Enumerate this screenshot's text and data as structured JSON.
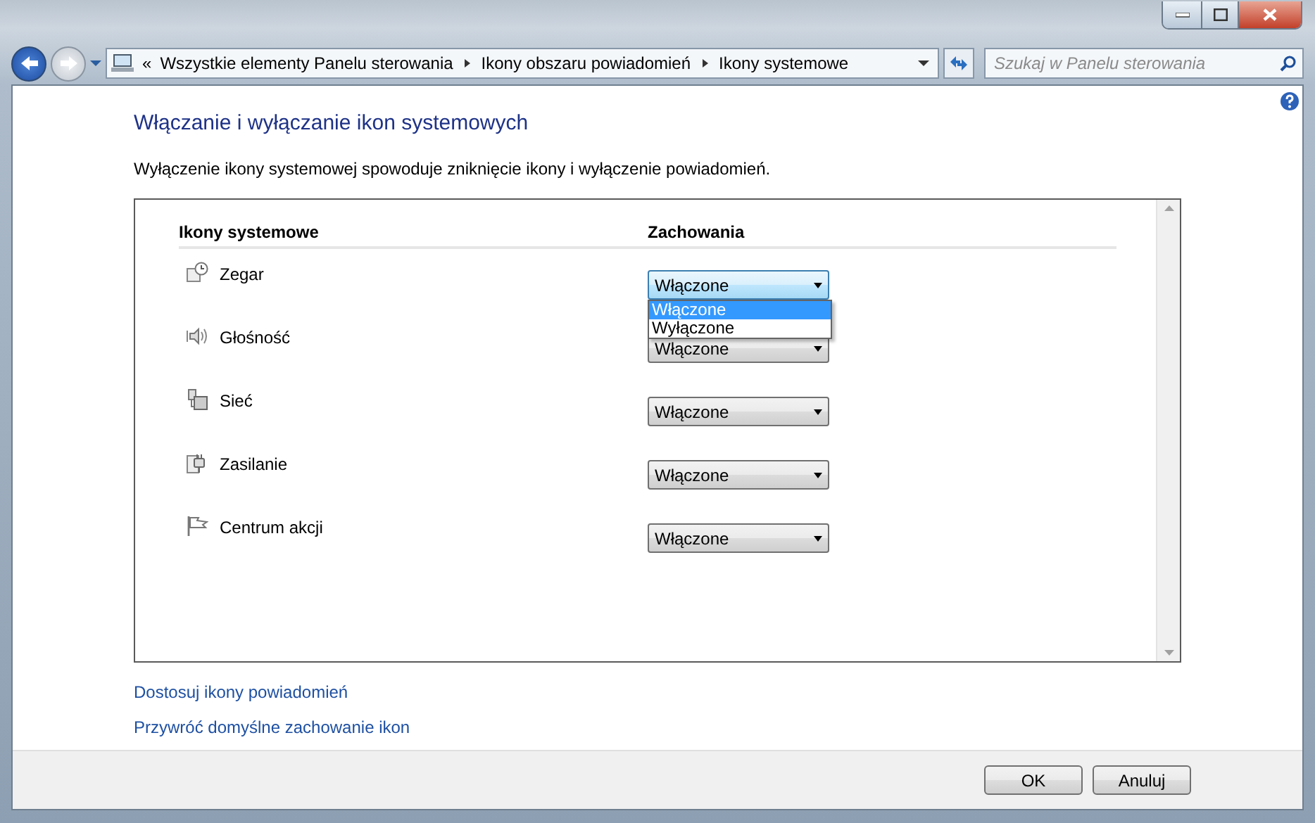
{
  "address_bar": {
    "overflow": "«",
    "crumbs": [
      "Wszystkie elementy Panelu sterowania",
      "Ikony obszaru powiadomień",
      "Ikony systemowe"
    ]
  },
  "search": {
    "placeholder": "Szukaj w Panelu sterowania"
  },
  "title": "Włączanie i wyłączanie ikon systemowych",
  "description": "Wyłączenie ikony systemowej spowoduje zniknięcie ikony i wyłączenie powiadomień.",
  "table": {
    "columns": [
      "Ikony systemowe",
      "Zachowania"
    ],
    "rows": [
      {
        "kind": "clock",
        "name": "Zegar",
        "value": "Włączone",
        "expanded": true,
        "options": [
          {
            "label": "Włączone",
            "selected": true
          },
          {
            "label": "Wyłączone",
            "selected": false
          }
        ]
      },
      {
        "kind": "volume",
        "name": "Głośność",
        "value": "Włączone",
        "expanded": false
      },
      {
        "kind": "network",
        "name": "Sieć",
        "value": "Włączone",
        "expanded": false
      },
      {
        "kind": "power",
        "name": "Zasilanie",
        "value": "Włączone",
        "expanded": false
      },
      {
        "kind": "flag",
        "name": "Centrum akcji",
        "value": "Włączone",
        "expanded": false
      }
    ]
  },
  "links": [
    "Dostosuj ikony powiadomień",
    "Przywróć domyślne zachowanie ikon"
  ],
  "buttons": [
    "OK",
    "Anuluj"
  ]
}
